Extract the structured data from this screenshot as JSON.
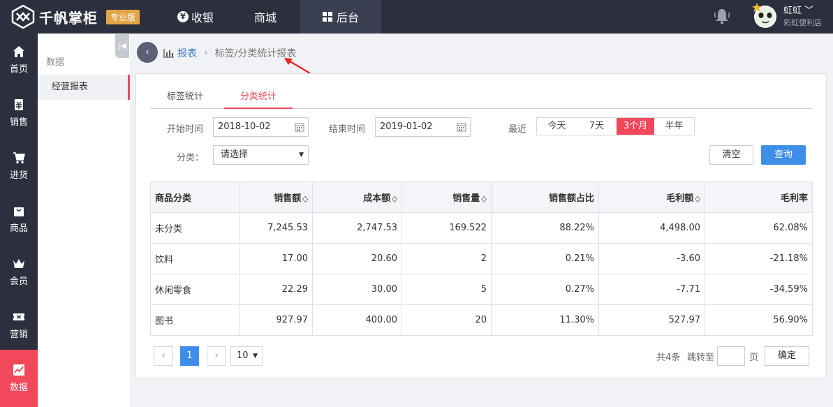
{
  "header": {
    "brand": "千帆掌柜",
    "edition_badge": "专业版",
    "nav": [
      {
        "label": "收银",
        "icon": "yuan-coin-icon"
      },
      {
        "label": "商城"
      },
      {
        "label": "后台",
        "icon": "grid-icon"
      }
    ],
    "user": {
      "name": "虹虹",
      "shop": "彩虹便利店"
    },
    "colors": {
      "bar": "#2c2f3e",
      "accent": "#f2485c",
      "primary": "#3d8ee8",
      "badge": "#e2a446"
    }
  },
  "sidebar": {
    "items": [
      {
        "label": "首页",
        "icon": "home-icon"
      },
      {
        "label": "销售",
        "icon": "sales-icon"
      },
      {
        "label": "进货",
        "icon": "cart-icon"
      },
      {
        "label": "商品",
        "icon": "bag-icon"
      },
      {
        "label": "会员",
        "icon": "crown-icon"
      },
      {
        "label": "营销",
        "icon": "ticket-icon"
      },
      {
        "label": "数据",
        "icon": "chart-icon",
        "active": true
      }
    ]
  },
  "subnav": {
    "title": "数据",
    "items": [
      {
        "label": "经营报表",
        "active": true
      }
    ]
  },
  "breadcrumb": {
    "link": "报表",
    "current": "标签/分类统计报表"
  },
  "tabs": [
    {
      "label": "标签统计",
      "active": false
    },
    {
      "label": "分类统计",
      "active": true
    }
  ],
  "filters": {
    "start_label": "开始时间",
    "start_value": "2018-10-02",
    "end_label": "结束时间",
    "end_value": "2019-01-02",
    "recent_label": "最近",
    "recent_options": [
      "今天",
      "7天",
      "3个月",
      "半年"
    ],
    "recent_selected": "3个月",
    "category_label": "分类：",
    "category_placeholder": "请选择",
    "clear_label": "清空",
    "query_label": "查询"
  },
  "table": {
    "columns": [
      "商品分类",
      "销售额",
      "成本额",
      "销售量",
      "销售额占比",
      "毛利额",
      "毛利率"
    ],
    "sortable": [
      false,
      true,
      true,
      true,
      false,
      true,
      false
    ],
    "rows": [
      [
        "未分类",
        "7,245.53",
        "2,747.53",
        "169.522",
        "88.22%",
        "4,498.00",
        "62.08%"
      ],
      [
        "饮料",
        "17.00",
        "20.60",
        "2",
        "0.21%",
        "-3.60",
        "-21.18%"
      ],
      [
        "休闲零食",
        "22.29",
        "30.00",
        "5",
        "0.27%",
        "-7.71",
        "-34.59%"
      ],
      [
        "图书",
        "927.97",
        "400.00",
        "20",
        "11.30%",
        "527.97",
        "56.90%"
      ]
    ]
  },
  "pagination": {
    "current_page": "1",
    "page_size": "10",
    "total": "共4条",
    "jump_label": "跳转至",
    "page_unit": "页",
    "confirm_label": "确定"
  }
}
